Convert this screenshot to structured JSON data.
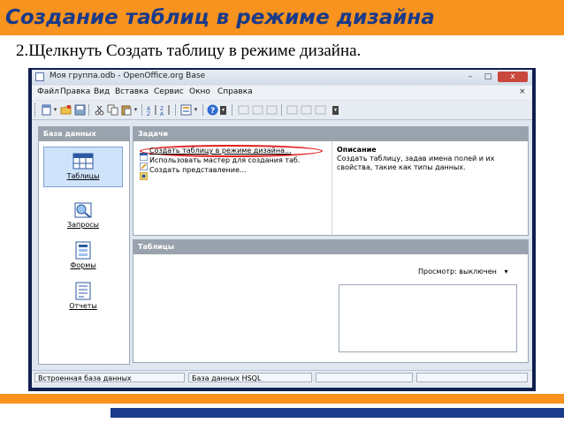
{
  "slide": {
    "title": "Создание таблиц в режиме дизайна",
    "step": "2.Щелкнуть Создать таблицу в режиме дизайна."
  },
  "window": {
    "title": "Моя группа.odb - OpenOffice.org Base",
    "controls": {
      "minimize": "–",
      "maximize": "□",
      "close": "x"
    }
  },
  "menu": [
    "Файл",
    "Правка",
    "Вид",
    "Вставка",
    "Сервис",
    "Окно",
    "Справка"
  ],
  "menu_close": "×",
  "toolbar": {
    "icons": [
      "new-doc-icon",
      "dropdown-arrow-icon",
      "open-folder-icon",
      "save-icon",
      "cut-icon",
      "copy-icon",
      "paste-icon",
      "dropdown-arrow-icon",
      "sort-ascending-icon",
      "sort-descending-icon",
      "form-icon",
      "dropdown-arrow-icon",
      "help-icon",
      "overflow-icon",
      "disabled-icons"
    ]
  },
  "database_pane": {
    "header": "База данных",
    "items": [
      {
        "label": "Таблицы",
        "icon": "tables-icon",
        "selected": true
      },
      {
        "label": "Запросы",
        "icon": "queries-icon",
        "selected": false
      },
      {
        "label": "Формы",
        "icon": "forms-icon",
        "selected": false
      },
      {
        "label": "Отчеты",
        "icon": "reports-icon",
        "selected": false
      }
    ]
  },
  "tasks_pane": {
    "header": "Задачи",
    "tasks": [
      "Создать таблицу в режиме дизайна...",
      "Использовать мастер для создания таб.",
      "Создать представление..."
    ],
    "description_title": "Описание",
    "description_text": "Создать таблицу, задав имена полей и их свойства, такие как типы данных."
  },
  "tables_pane": {
    "header": "Таблицы",
    "preview_label": "Просмотр: выключен",
    "preview_arrow": "▾"
  },
  "statusbar": [
    "Встроенная база данных",
    "База данных HSQL",
    "",
    ""
  ],
  "colors": {
    "accent_orange": "#f7931e",
    "title_blue": "#1a3a8a",
    "highlight_red": "#e02020"
  }
}
